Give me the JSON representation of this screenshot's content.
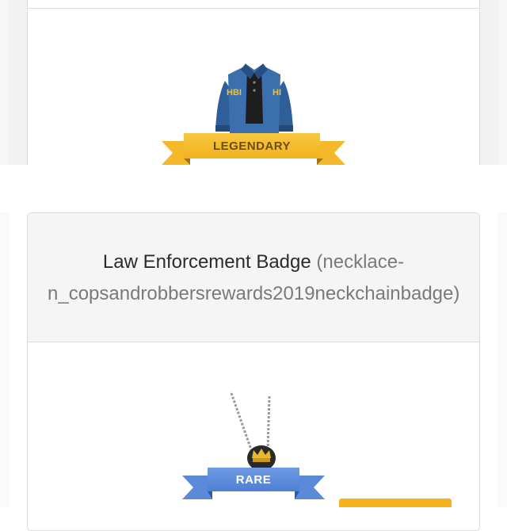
{
  "top_item": {
    "image": "fbi-jacket-icon",
    "rarity_label": "LEGENDARY",
    "rarity_color": "#f5b82a"
  },
  "item": {
    "name": "Law Enforcement Badge",
    "id_text": "(necklace-n_copsandrobbersrewards2019neckchainbadge)",
    "image": "law-enforcement-badge-icon",
    "rarity_label": "RARE",
    "rarity_color": "#5b8ad8"
  },
  "colors": {
    "accent_orange": "#f6b21c",
    "border": "#dcdcdc",
    "header_bg": "#f5f5f5"
  }
}
